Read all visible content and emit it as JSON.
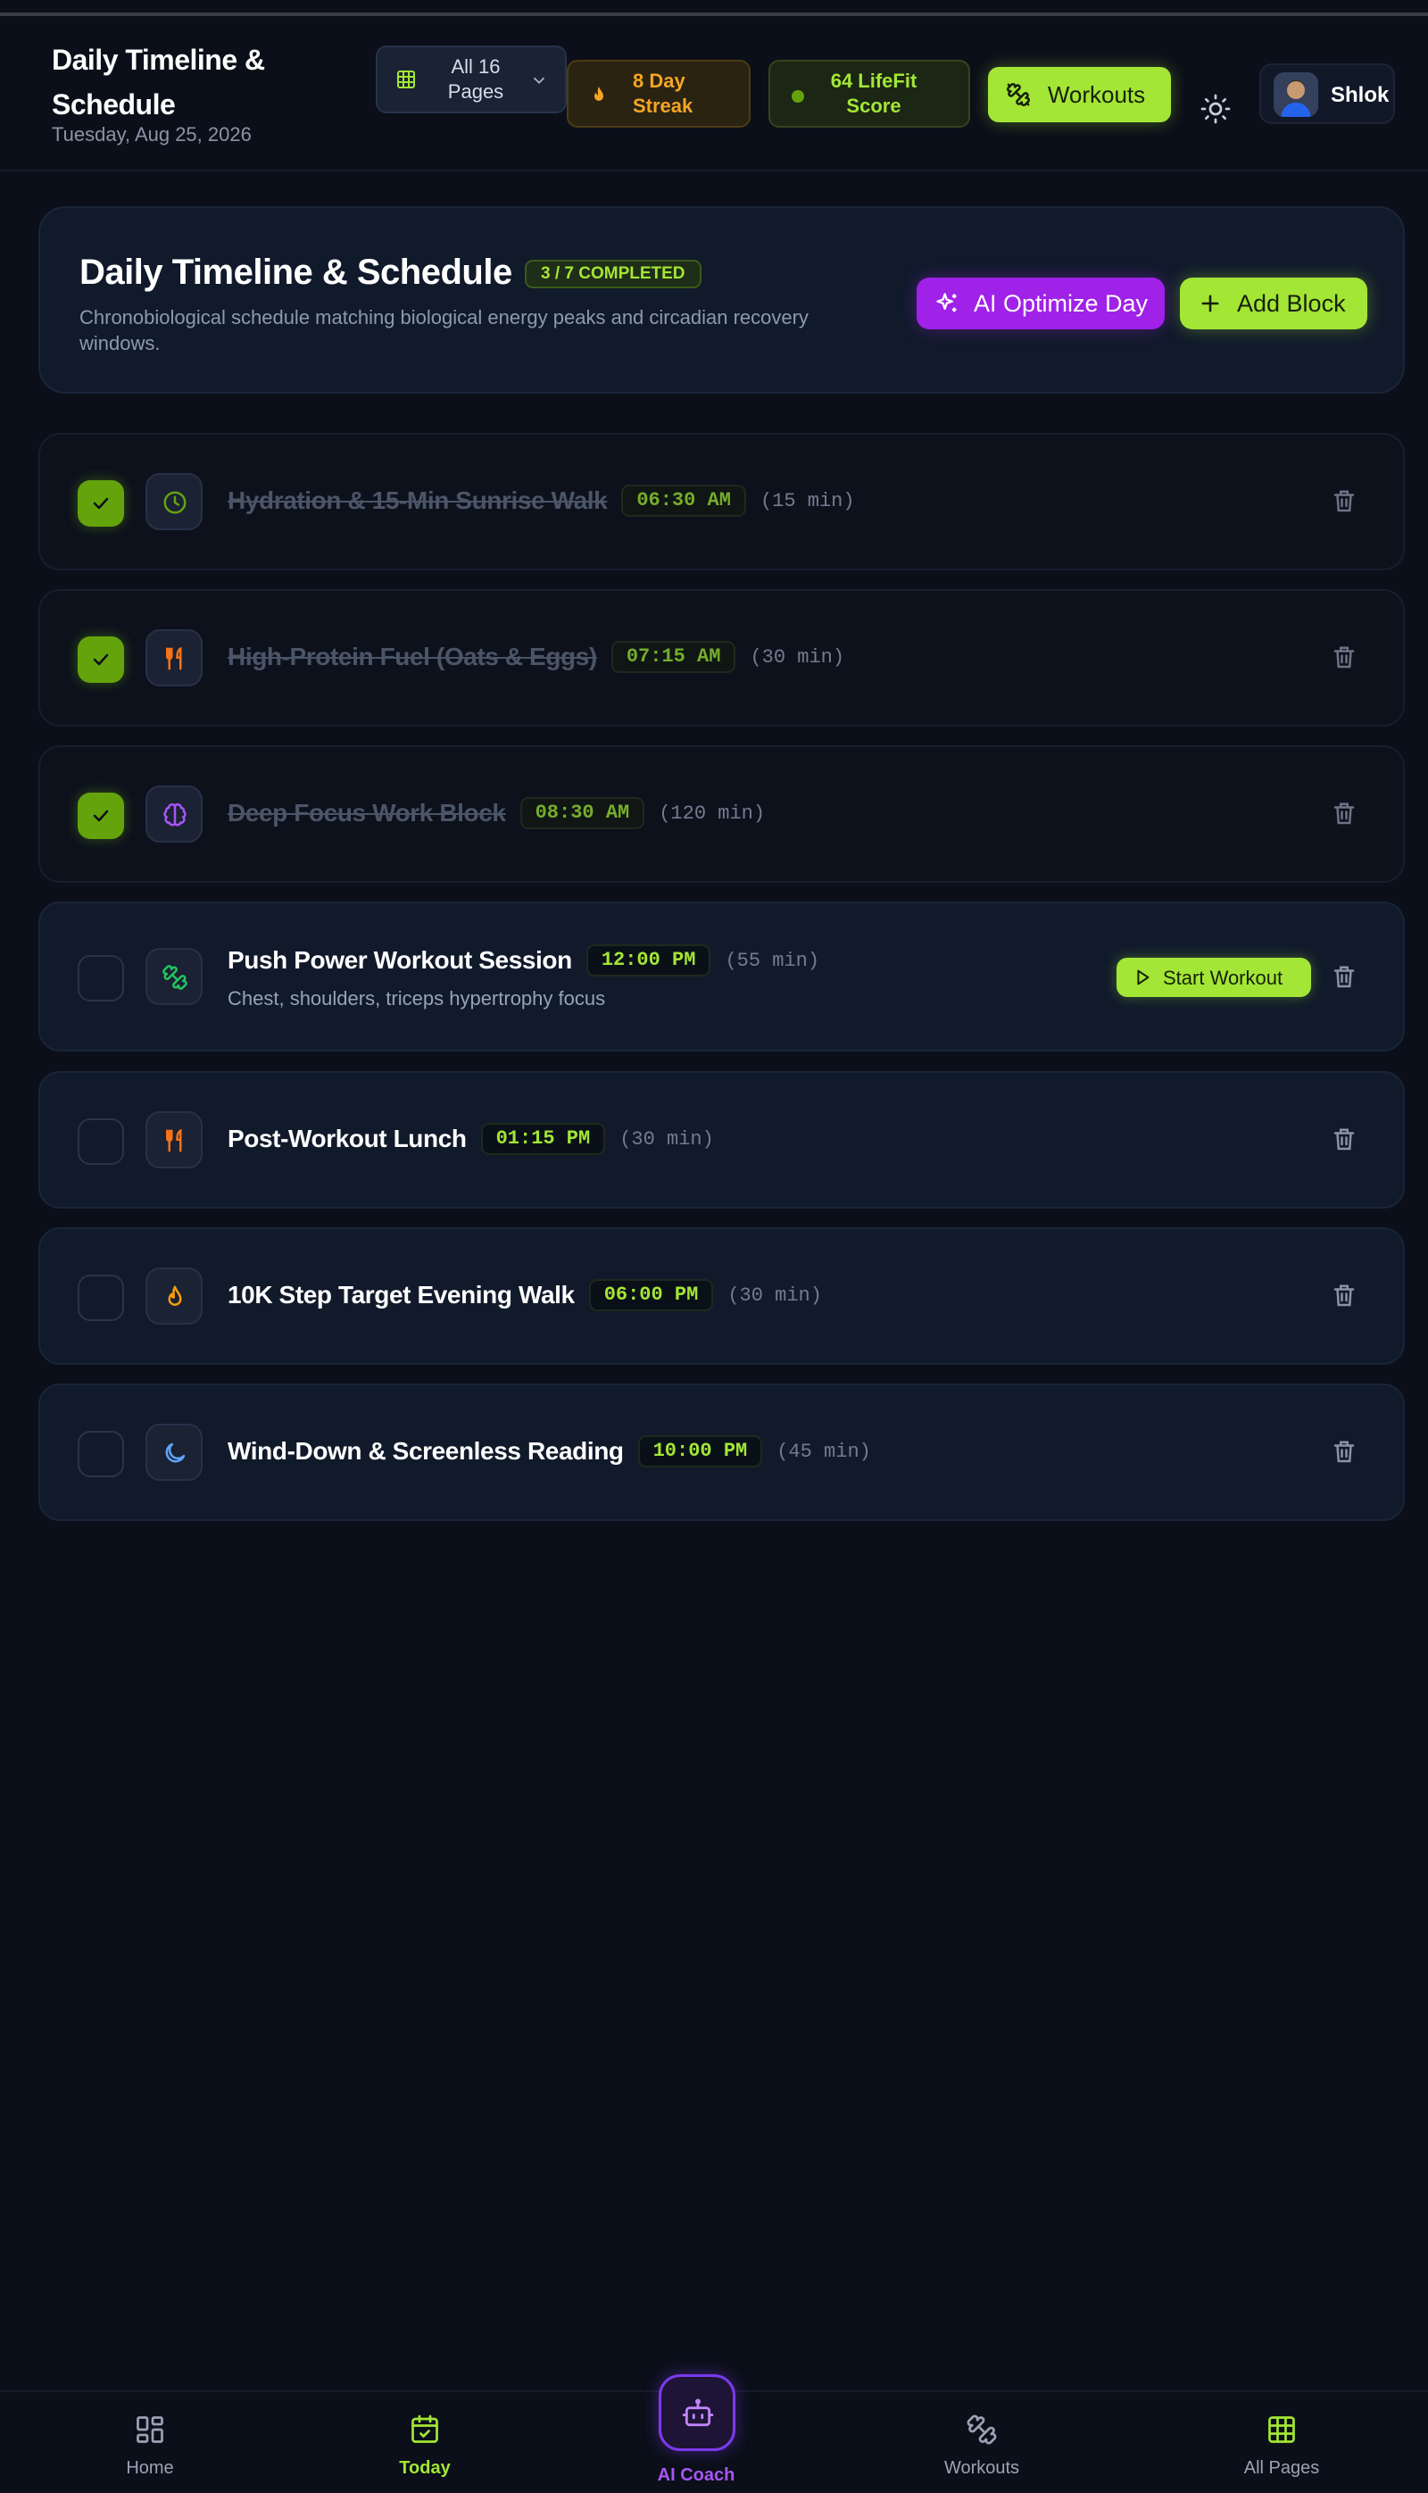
{
  "header": {
    "title": "Daily Timeline & Schedule",
    "date": "Tuesday, Aug 25, 2026",
    "pages_label": "All 16 Pages",
    "streak_label": "8 Day Streak",
    "score_label": "64 LifeFit Score",
    "workouts_label": "Workouts",
    "user_name": "Shlok"
  },
  "hero": {
    "title": "Daily Timeline & Schedule",
    "badge": "3 / 7 COMPLETED",
    "description": "Chronobiological schedule matching biological energy peaks and circadian recovery windows.",
    "ai_button": "AI Optimize Day",
    "add_button": "Add Block"
  },
  "timeline": [
    {
      "name": "Hydration & 15-Min Sunrise Walk",
      "time": "06:30 AM",
      "duration": "(15 min)",
      "done": true,
      "icon": "clock-icon",
      "icon_color": "#65a30d"
    },
    {
      "name": "High-Protein Fuel (Oats & Eggs)",
      "time": "07:15 AM",
      "duration": "(30 min)",
      "done": true,
      "icon": "utensils-icon",
      "icon_color": "#f97316"
    },
    {
      "name": "Deep Focus Work Block",
      "time": "08:30 AM",
      "duration": "(120 min)",
      "done": true,
      "icon": "brain-icon",
      "icon_color": "#a855f7"
    },
    {
      "name": "Push Power Workout Session",
      "time": "12:00 PM",
      "duration": "(55 min)",
      "done": false,
      "icon": "dumbbell-icon",
      "icon_color": "#22c55e",
      "subtitle": "Chest, shoulders, triceps hypertrophy focus",
      "action": "Start Workout"
    },
    {
      "name": "Post-Workout Lunch",
      "time": "01:15 PM",
      "duration": "(30 min)",
      "done": false,
      "icon": "utensils-icon",
      "icon_color": "#f97316"
    },
    {
      "name": "10K Step Target Evening Walk",
      "time": "06:00 PM",
      "duration": "(30 min)",
      "done": false,
      "icon": "flame-icon",
      "icon_color": "#f59e0b"
    },
    {
      "name": "Wind-Down & Screenless Reading",
      "time": "10:00 PM",
      "duration": "(45 min)",
      "done": false,
      "icon": "moon-icon",
      "icon_color": "#60a5fa"
    }
  ],
  "nav": {
    "home": "Home",
    "today": "Today",
    "coach": "AI Coach",
    "workouts": "Workouts",
    "all_pages": "All Pages"
  },
  "colors": {
    "accent": "#a3e635",
    "purple": "#a021e8",
    "background": "#0b0f19"
  }
}
